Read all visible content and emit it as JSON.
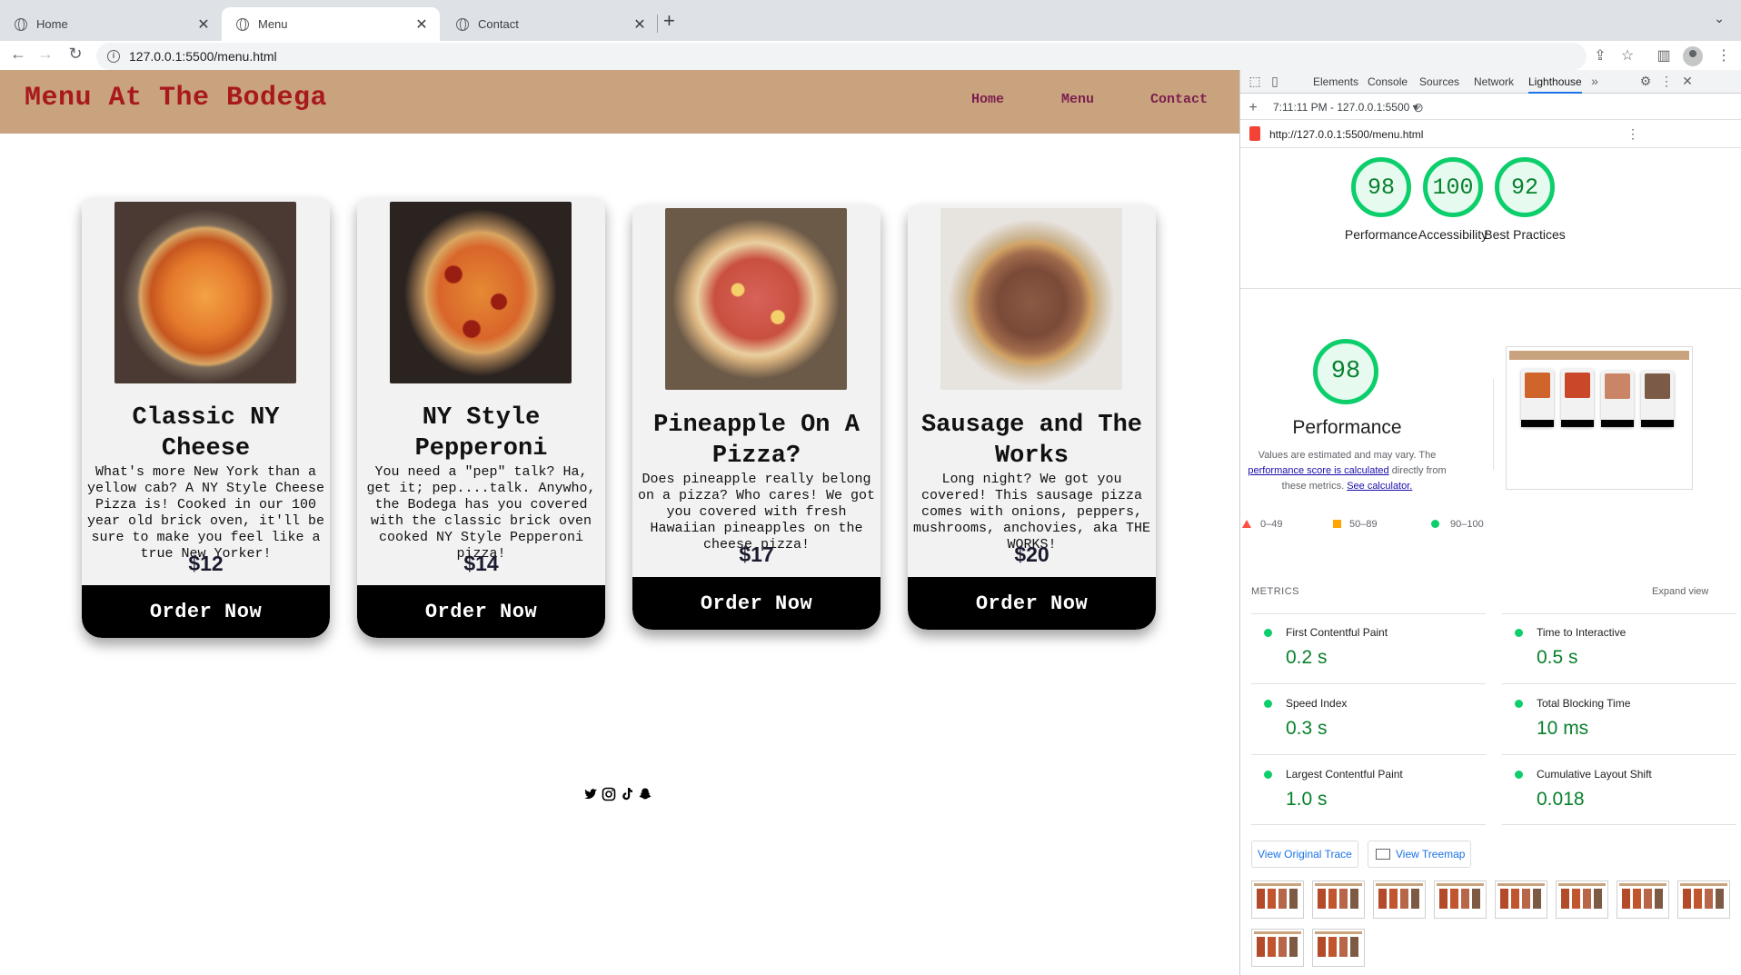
{
  "browser": {
    "tabs": [
      {
        "label": "Home",
        "active": false
      },
      {
        "label": "Menu",
        "active": true
      },
      {
        "label": "Contact",
        "active": false
      }
    ],
    "url": "127.0.0.1:5500/menu.html"
  },
  "site": {
    "title": "Menu At The Bodega",
    "nav": [
      "Home",
      "Menu",
      "Contact"
    ],
    "cards": [
      {
        "name": "Classic NY Cheese",
        "description": "What's more New York than a yellow cab? A NY Style Cheese Pizza is! Cooked in our 100 year old brick oven, it'll be sure to make you feel like a true New Yorker!",
        "price": "$12",
        "button": "Order Now"
      },
      {
        "name": "NY Style Pepperoni",
        "description": "You need a \"pep\" talk? Ha, get it; pep....talk. Anywho, the Bodega has you covered with the classic brick oven cooked NY Style Pepperoni pizza!",
        "price": "$14",
        "button": "Order Now"
      },
      {
        "name": "Pineapple On A Pizza?",
        "description": "Does pineapple really belong on a pizza? Who cares! We got you covered with fresh Hawaiian pineapples on the cheese pizza!",
        "price": "$17",
        "button": "Order Now"
      },
      {
        "name": "Sausage and The Works",
        "description": "Long night? We got you covered! This sausage pizza comes with onions, peppers, mushrooms, anchovies, aka THE WORKS!",
        "price": "$20",
        "button": "Order Now"
      }
    ],
    "socials": [
      "twitter-icon",
      "instagram-icon",
      "tiktok-icon",
      "snapchat-icon"
    ]
  },
  "devtools": {
    "tabs": [
      "Elements",
      "Console",
      "Sources",
      "Network",
      "Lighthouse"
    ],
    "active_tab": "Lighthouse",
    "report_selector": "7:11:11 PM - 127.0.0.1:5500",
    "report_url": "http://127.0.0.1:5500/menu.html",
    "scores": [
      {
        "label": "Performance",
        "value": "98"
      },
      {
        "label": "Accessibility",
        "value": "100"
      },
      {
        "label": "Best Practices",
        "value": "92"
      }
    ],
    "performance": {
      "score": "98",
      "title": "Performance",
      "note_prefix": "Values are estimated and may vary. The",
      "note_link1": "performance score is calculated",
      "note_mid": "directly from these metrics.",
      "note_link2": "See calculator.",
      "legend": [
        "0–49",
        "50–89",
        "90–100"
      ]
    },
    "metrics_title": "METRICS",
    "expand_label": "Expand view",
    "metrics": [
      {
        "name": "First Contentful Paint",
        "value": "0.2 s"
      },
      {
        "name": "Time to Interactive",
        "value": "0.5 s"
      },
      {
        "name": "Speed Index",
        "value": "0.3 s"
      },
      {
        "name": "Total Blocking Time",
        "value": "10 ms"
      },
      {
        "name": "Largest Contentful Paint",
        "value": "1.0 s"
      },
      {
        "name": "Cumulative Layout Shift",
        "value": "0.018"
      }
    ],
    "view_trace": "View Original Trace",
    "view_treemap": "View Treemap",
    "colors": {
      "pass": "#0cce6b",
      "average": "#ffa400",
      "fail": "#ff4e42"
    }
  }
}
